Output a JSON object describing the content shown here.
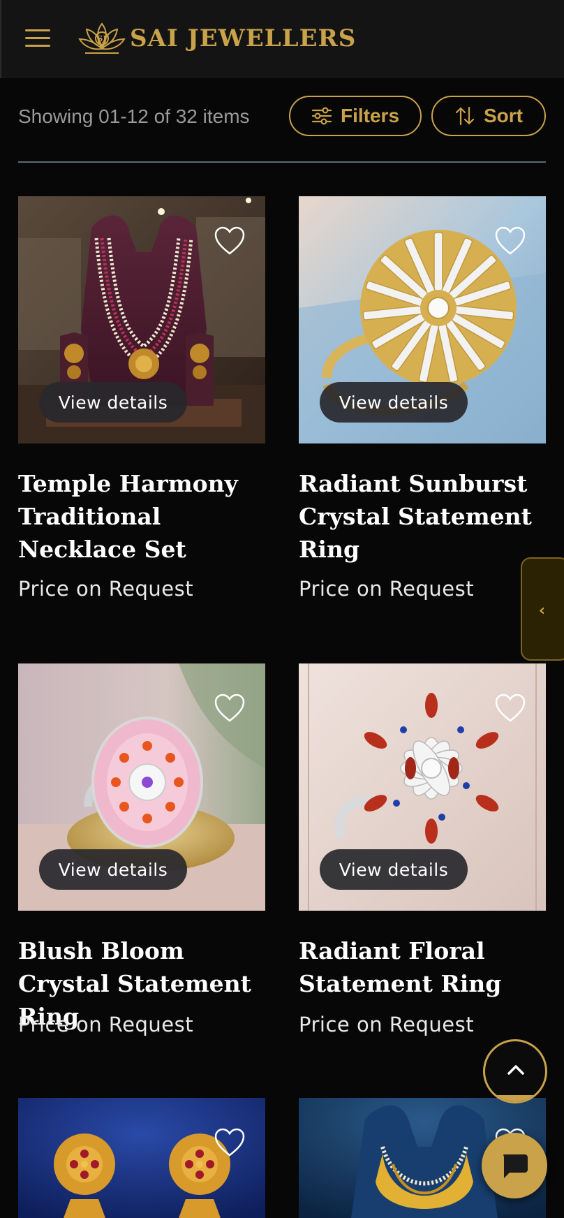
{
  "brand": {
    "name": "SAI JEWELLERS",
    "accent_color": "#c9a24a"
  },
  "header": {
    "menu_icon": "hamburger-menu-icon",
    "logo_icon": "lotus-logo-icon"
  },
  "toolbar": {
    "count_text": "Showing 01-12 of 32 items",
    "filters_label": "Filters",
    "filters_icon": "sliders-icon",
    "sort_label": "Sort",
    "sort_icon": "sort-arrows-icon"
  },
  "products": [
    {
      "title": "Temple Harmony Traditional Necklace Set",
      "price": "Price on Request",
      "view_label": "View details"
    },
    {
      "title": "Radiant Sunburst Crystal Statement Ring",
      "price": "Price on Request",
      "view_label": "View details"
    },
    {
      "title": "Blush Bloom Crystal Statement Ring",
      "price": "Price on Request",
      "view_label": "View details"
    },
    {
      "title": "Radiant Floral Statement Ring",
      "price": "Price on Request",
      "view_label": "View details"
    },
    {
      "title": "",
      "price": "",
      "view_label": ""
    },
    {
      "title": "",
      "price": "",
      "view_label": ""
    }
  ],
  "floating": {
    "side_tab_icon": "chevron-left-icon",
    "scroll_top_icon": "chevron-up-icon",
    "scroll_progress": 0.1,
    "chat_icon": "chat-bubble-icon"
  }
}
